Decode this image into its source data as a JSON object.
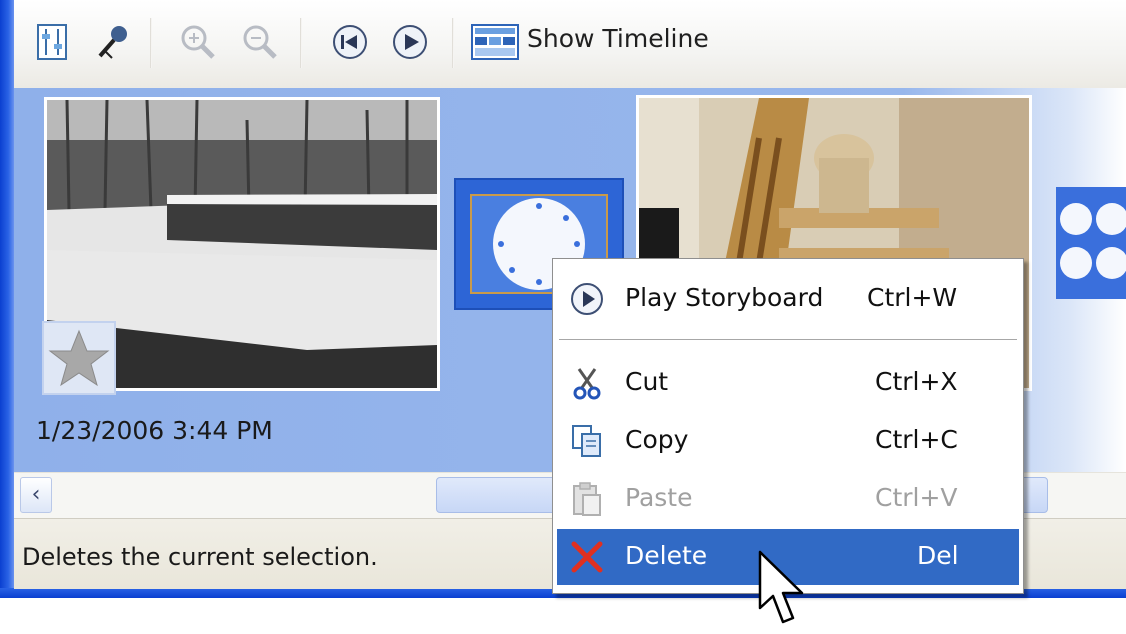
{
  "toolbar": {
    "show_timeline_label": "Show Timeline",
    "icons": [
      "set-audio-levels-icon",
      "narrate-timeline-icon",
      "zoom-in-icon",
      "zoom-out-icon",
      "rewind-storyboard-icon",
      "play-storyboard-icon",
      "show-timeline-icon"
    ]
  },
  "storyboard": {
    "clip1_date": "1/23/2006 3:44 PM"
  },
  "statusbar": {
    "text": "Deletes the current selection."
  },
  "context_menu": {
    "items": [
      {
        "label": "Play Storyboard",
        "shortcut": "Ctrl+W",
        "enabled": true,
        "icon": "play-icon"
      },
      {
        "label": "Cut",
        "shortcut": "Ctrl+X",
        "enabled": true,
        "icon": "scissors-icon"
      },
      {
        "label": "Copy",
        "shortcut": "Ctrl+C",
        "enabled": true,
        "icon": "copy-icon"
      },
      {
        "label": "Paste",
        "shortcut": "Ctrl+V",
        "enabled": false,
        "icon": "paste-icon"
      },
      {
        "label": "Delete",
        "shortcut": "Del",
        "enabled": true,
        "selected": true,
        "icon": "delete-x-icon"
      }
    ]
  },
  "colors": {
    "selection": "#316ac5",
    "storyboard_bg": "#98b7ec",
    "window_frame": "#0a3fd0"
  }
}
